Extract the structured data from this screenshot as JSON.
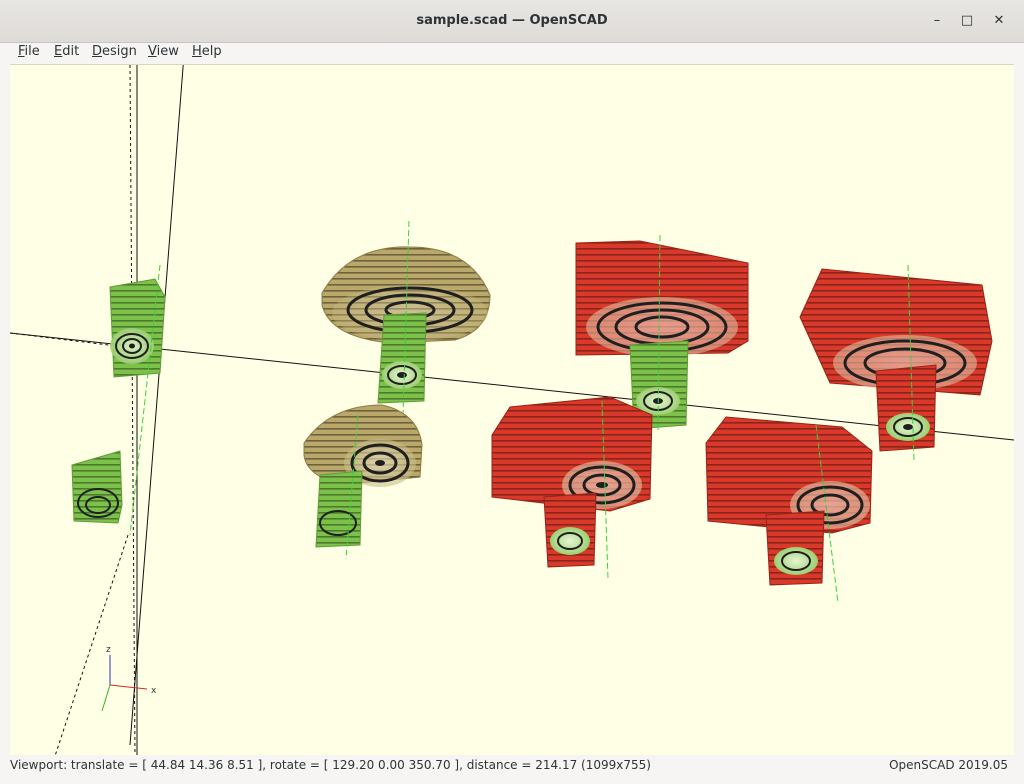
{
  "window": {
    "title": "sample.scad — OpenSCAD",
    "minimize_icon": "minimize-icon",
    "maximize_icon": "maximize-icon",
    "close_icon": "close-icon"
  },
  "menubar": {
    "items": [
      {
        "label": "File",
        "accelerator": "F",
        "rest": "ile"
      },
      {
        "label": "Edit",
        "accelerator": "E",
        "rest": "dit"
      },
      {
        "label": "Design",
        "accelerator": "D",
        "rest": "esign"
      },
      {
        "label": "View",
        "accelerator": "V",
        "rest": "iew"
      },
      {
        "label": "Help",
        "accelerator": "H",
        "rest": "elp"
      }
    ]
  },
  "viewport": {
    "background_color": "#ffffe5",
    "axis_gizmo": {
      "x_label": "x",
      "z_label": "z"
    },
    "colors": {
      "green": "#7cc24a",
      "tan": "#b9a86a",
      "red": "#d9392b",
      "rings": "#1f1f1f"
    }
  },
  "status": {
    "viewport_text": "Viewport: translate = [ 44.84 14.36 8.51 ], rotate = [ 129.20 0.00 350.70 ], distance = 214.17 (1099x755)",
    "version": "OpenSCAD 2019.05"
  }
}
